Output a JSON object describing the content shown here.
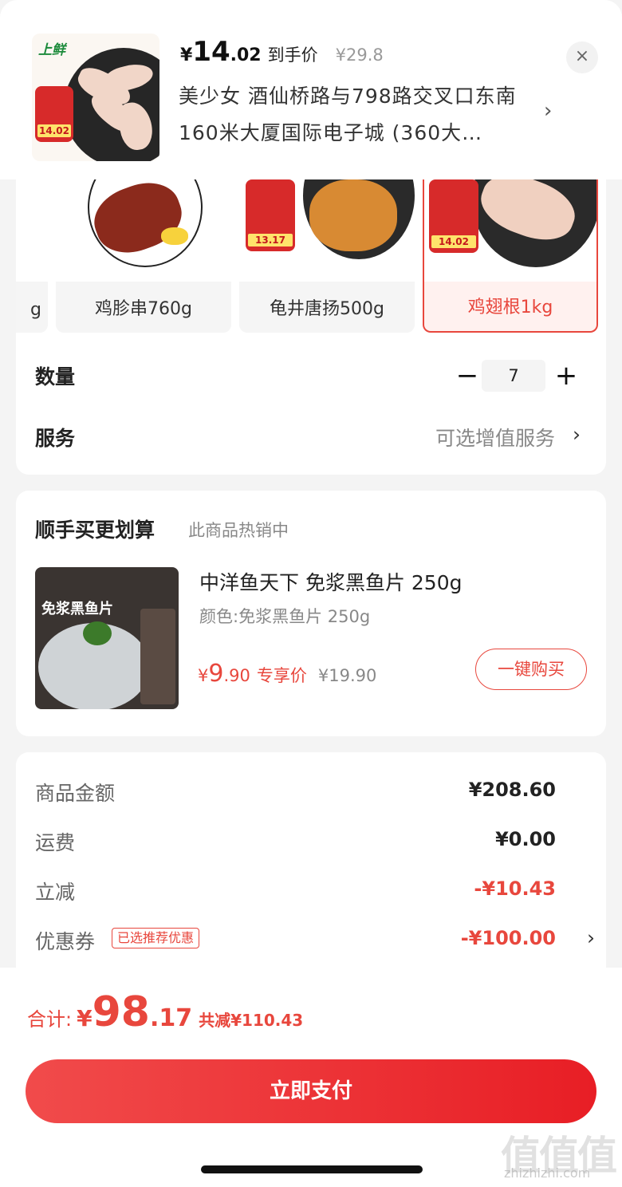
{
  "header": {
    "product_logo": "上鲜",
    "thumb_tag_price": "14.02",
    "price_currency": "¥",
    "price_int": "14",
    "price_dec": ".02",
    "price_label": "到手价",
    "original_price": "¥29.8",
    "address": "美少女  酒仙桥路与798路交叉口东南160米大厦国际电子城 (360大…",
    "chevron": "›",
    "close_icon": "×"
  },
  "skus": [
    {
      "label": "g",
      "selected": false
    },
    {
      "label": "鸡胗串760g",
      "selected": false
    },
    {
      "label": "龟井唐扬500g",
      "selected": false,
      "tag_price": "13.17"
    },
    {
      "label": "鸡翅根1kg",
      "selected": true,
      "tag_price": "14.02"
    }
  ],
  "quantity": {
    "label": "数量",
    "minus": "−",
    "value": "7",
    "plus": "+"
  },
  "service": {
    "label": "服务",
    "value": "可选增值服务",
    "chevron": "›"
  },
  "upsell": {
    "title": "顺手买更划算",
    "subtitle": "此商品热销中",
    "image_text": "免浆黑鱼片",
    "product_name": "中洋鱼天下 免浆黑鱼片 250g",
    "color_text": "颜色:免浆黑鱼片 250g",
    "price_currency": "¥",
    "price_int": "9",
    "price_dec": ".90",
    "price_label": "专享价",
    "original_price": "¥19.90",
    "buy_label": "一键购买"
  },
  "summary": {
    "rows": [
      {
        "label": "商品金额",
        "value": "¥208.60"
      },
      {
        "label": "运费",
        "value": "¥0.00"
      },
      {
        "label": "立减",
        "value": "-¥10.43"
      },
      {
        "label": "优惠券",
        "value": "-¥100.00"
      }
    ],
    "coupon_tag": "已选推荐优惠",
    "chevron": "›"
  },
  "footer": {
    "total_label": "合计:",
    "total_currency": "¥",
    "total_int": "98",
    "total_dec": ".17",
    "saved_text": "共减¥110.43",
    "pay_label": "立即支付"
  },
  "watermark": {
    "text": "值值值",
    "url": "zhizhizhi.com"
  },
  "colors": {
    "accent_red": "#e8473d",
    "pay_button": "#ef2d30"
  }
}
